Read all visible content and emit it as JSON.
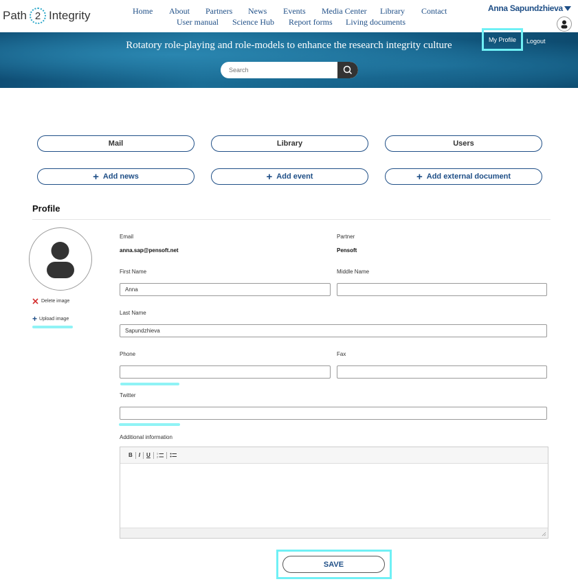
{
  "header": {
    "logo": {
      "prefix": "Path",
      "number": "2",
      "suffix": "Integrity"
    },
    "nav_row1": [
      "Home",
      "About",
      "Partners",
      "News",
      "Events",
      "Media Center",
      "Library",
      "Contact"
    ],
    "nav_row2": [
      "User manual",
      "Science Hub",
      "Report forms",
      "Living documents"
    ],
    "user_name": "Anna Sapundzhieva",
    "my_profile": "My Profile",
    "logout": "Logout"
  },
  "banner": {
    "tagline": "Rotatory role-playing and role-models to enhance the research integrity culture",
    "search_placeholder": "Search"
  },
  "actions": {
    "mail": "Mail",
    "library": "Library",
    "users": "Users",
    "add_news": "Add news",
    "add_event": "Add event",
    "add_external_document": "Add external document"
  },
  "profile": {
    "title": "Profile",
    "delete_image": "Delete image",
    "upload_image": "Upload image",
    "email_label": "Email",
    "email_value": "anna.sap@pensoft.net",
    "partner_label": "Partner",
    "partner_value": "Pensoft",
    "first_name_label": "First Name",
    "first_name_value": "Anna",
    "middle_name_label": "Middle Name",
    "middle_name_value": "",
    "last_name_label": "Last Name",
    "last_name_value": "Sapundzhieva",
    "phone_label": "Phone",
    "phone_value": "",
    "fax_label": "Fax",
    "fax_value": "",
    "twitter_label": "Twitter",
    "twitter_value": "",
    "additional_info_label": "Additional information",
    "editor_toolbar": {
      "bold": "B",
      "italic": "I",
      "underline": "U"
    },
    "save_label": "SAVE"
  },
  "colors": {
    "link": "#1e4e86",
    "highlight": "#6ff0f5",
    "banner": "#1a6d95"
  }
}
